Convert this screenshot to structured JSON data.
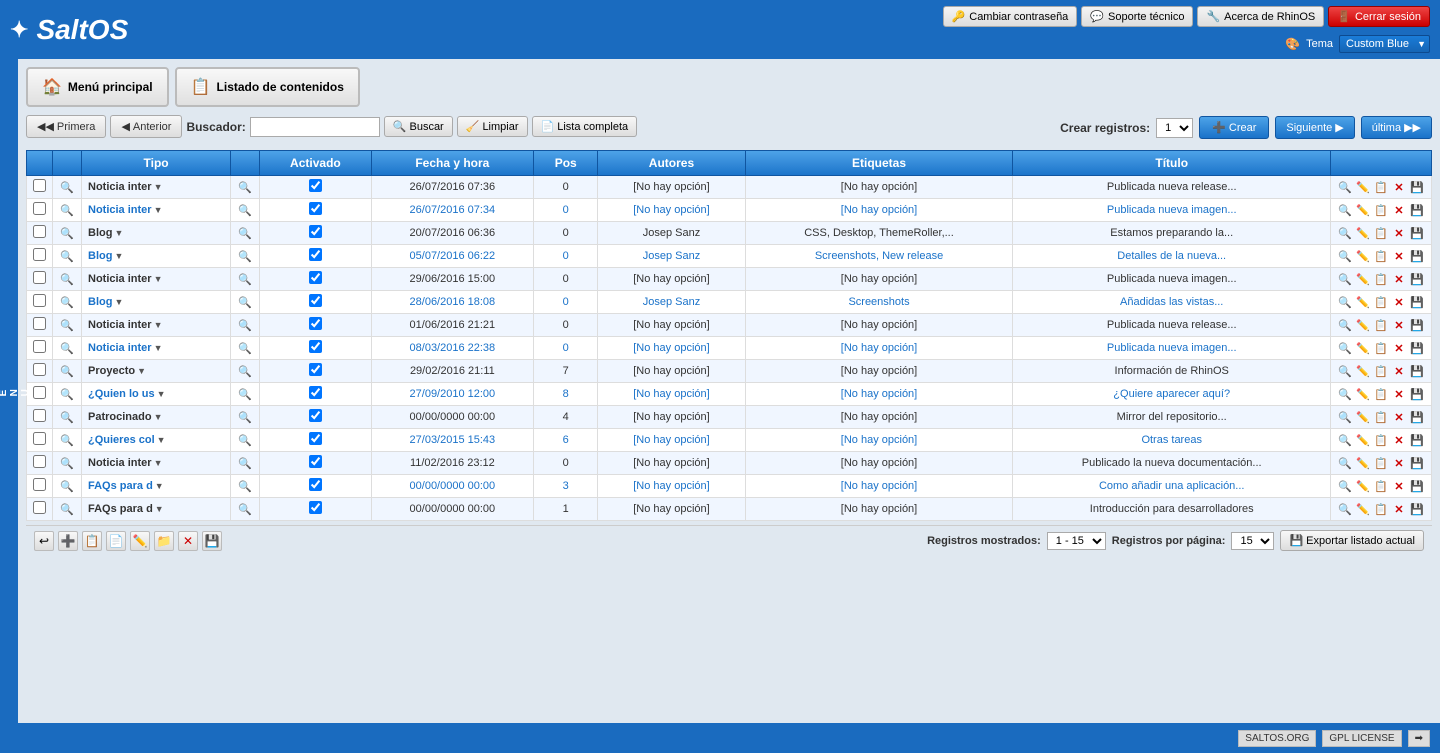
{
  "app": {
    "logo": "SaltOS",
    "logo_icon": "✦"
  },
  "header": {
    "buttons": [
      {
        "label": "Cambiar contraseña",
        "icon": "🔑",
        "name": "change-password"
      },
      {
        "label": "Soporte técnico",
        "icon": "💬",
        "name": "support"
      },
      {
        "label": "Acerca de RhinOS",
        "icon": "🔧",
        "name": "about"
      },
      {
        "label": "Cerrar sesión",
        "icon": "🚪",
        "name": "logout"
      }
    ],
    "theme_label": "Tema",
    "theme_value": "Custom Blue"
  },
  "nav": {
    "menu_principal": "Menú principal",
    "listado_contenidos": "Listado de contenidos"
  },
  "controls": {
    "primera": "Primera",
    "anterior": "Anterior",
    "siguiente": "Siguiente",
    "ultima": "última",
    "buscador_label": "Buscador:",
    "buscar": "Buscar",
    "limpiar": "Limpiar",
    "lista_completa": "Lista completa",
    "crear_registros": "Crear registros:",
    "crear_value": "1",
    "crear_btn": "Crear"
  },
  "table": {
    "headers": [
      "",
      "",
      "Tipo",
      "",
      "Activado",
      "Fecha y hora",
      "Pos",
      "Autores",
      "Etiquetas",
      "Título",
      ""
    ],
    "rows": [
      {
        "checked": false,
        "type": "Noticia inter",
        "activated": true,
        "date": "26/07/2016 07:36",
        "pos": "0",
        "authors": "[No hay opción]",
        "tags": "[No hay opción]",
        "title": "Publicada nueva release...",
        "highlight": false
      },
      {
        "checked": false,
        "type": "Noticia inter",
        "activated": true,
        "date": "26/07/2016 07:34",
        "pos": "0",
        "authors": "[No hay opción]",
        "tags": "[No hay opción]",
        "title": "Publicada nueva imagen...",
        "highlight": true
      },
      {
        "checked": false,
        "type": "Blog",
        "activated": true,
        "date": "20/07/2016 06:36",
        "pos": "0",
        "authors": "Josep Sanz",
        "tags": "CSS, Desktop, ThemeRoller,...",
        "title": "Estamos preparando la...",
        "highlight": false
      },
      {
        "checked": false,
        "type": "Blog",
        "activated": true,
        "date": "05/07/2016 06:22",
        "pos": "0",
        "authors": "Josep Sanz",
        "tags": "Screenshots, New release",
        "title": "Detalles de la nueva...",
        "highlight": true
      },
      {
        "checked": false,
        "type": "Noticia inter",
        "activated": true,
        "date": "29/06/2016 15:00",
        "pos": "0",
        "authors": "[No hay opción]",
        "tags": "[No hay opción]",
        "title": "Publicada nueva imagen...",
        "highlight": false
      },
      {
        "checked": false,
        "type": "Blog",
        "activated": true,
        "date": "28/06/2016 18:08",
        "pos": "0",
        "authors": "Josep Sanz",
        "tags": "Screenshots",
        "title": "Añadidas las vistas...",
        "highlight": true
      },
      {
        "checked": false,
        "type": "Noticia inter",
        "activated": true,
        "date": "01/06/2016 21:21",
        "pos": "0",
        "authors": "[No hay opción]",
        "tags": "[No hay opción]",
        "title": "Publicada nueva release...",
        "highlight": false
      },
      {
        "checked": false,
        "type": "Noticia inter",
        "activated": true,
        "date": "08/03/2016 22:38",
        "pos": "0",
        "authors": "[No hay opción]",
        "tags": "[No hay opción]",
        "title": "Publicada nueva imagen...",
        "highlight": true
      },
      {
        "checked": false,
        "type": "Proyecto",
        "activated": true,
        "date": "29/02/2016 21:11",
        "pos": "7",
        "authors": "[No hay opción]",
        "tags": "[No hay opción]",
        "title": "Información de RhinOS",
        "highlight": false
      },
      {
        "checked": false,
        "type": "¿Quien lo us",
        "activated": true,
        "date": "27/09/2010 12:00",
        "pos": "8",
        "authors": "[No hay opción]",
        "tags": "[No hay opción]",
        "title": "¿Quiere aparecer aquí?",
        "highlight": true
      },
      {
        "checked": false,
        "type": "Patrocinado",
        "activated": true,
        "date": "00/00/0000 00:00",
        "pos": "4",
        "authors": "[No hay opción]",
        "tags": "[No hay opción]",
        "title": "Mirror del repositorio...",
        "highlight": false
      },
      {
        "checked": false,
        "type": "¿Quieres col",
        "activated": true,
        "date": "27/03/2015 15:43",
        "pos": "6",
        "authors": "[No hay opción]",
        "tags": "[No hay opción]",
        "title": "Otras tareas",
        "highlight": true
      },
      {
        "checked": false,
        "type": "Noticia inter",
        "activated": true,
        "date": "11/02/2016 23:12",
        "pos": "0",
        "authors": "[No hay opción]",
        "tags": "[No hay opción]",
        "title": "Publicado la nueva documentación...",
        "highlight": false
      },
      {
        "checked": false,
        "type": "FAQs para d",
        "activated": true,
        "date": "00/00/0000 00:00",
        "pos": "3",
        "authors": "[No hay opción]",
        "tags": "[No hay opción]",
        "title": "Como añadir una aplicación...",
        "highlight": true
      },
      {
        "checked": false,
        "type": "FAQs para d",
        "activated": true,
        "date": "00/00/0000 00:00",
        "pos": "1",
        "authors": "[No hay opción]",
        "tags": "[No hay opción]",
        "title": "Introducción para desarrolladores",
        "highlight": false
      }
    ]
  },
  "footer": {
    "registros_mostrados_label": "Registros mostrados:",
    "registros_mostrados_value": "1 - 15",
    "registros_por_pagina_label": "Registros por página:",
    "registros_por_pagina_value": "15",
    "exportar": "Exportar listado actual"
  },
  "bottom_footer": {
    "saltos_org": "SALTOS.ORG",
    "gpl_license": "GPL LICENSE"
  },
  "side_menu": {
    "label": "MENU"
  }
}
